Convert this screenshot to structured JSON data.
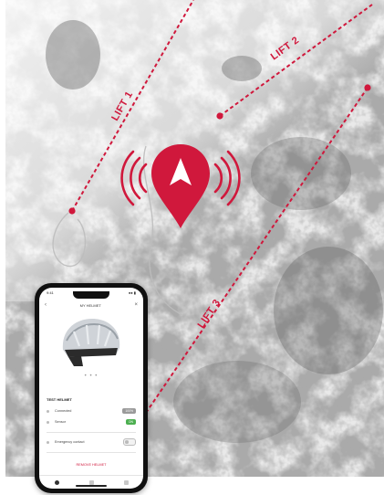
{
  "map": {
    "style": "grayscale satellite terrain, snowy slopes and forest patches",
    "accent_color": "#d0183c",
    "lifts": [
      {
        "name": "LIFT 1",
        "style": "dashed",
        "start_marker": true,
        "end_marker": false
      },
      {
        "name": "LIFT 2",
        "style": "dashed",
        "start_marker": true,
        "end_marker": false
      },
      {
        "name": "LIFT 3",
        "style": "dashed",
        "start_marker": false,
        "end_marker": true
      }
    ],
    "locator": {
      "icon": "location-pin-signal-icon"
    }
  },
  "phone": {
    "status_time": "9:41",
    "status_icons": "●● ▮",
    "header_title": "MY HELMET",
    "back_icon": "chevron-left-icon",
    "close_icon": "close-icon",
    "pager_dots": "• • •",
    "section_title": "TEST HELMET",
    "rows": [
      {
        "label": "Connected",
        "value": "100%",
        "badge_color": "#9a9a9a"
      },
      {
        "label": "Sensor",
        "value": "ON",
        "badge_color": "#4caf50"
      },
      {
        "label": "Emergency contact",
        "value": ""
      }
    ],
    "link": "REMOVE HELMET",
    "tabs": [
      "home-tab-icon",
      "map-tab-icon",
      "profile-tab-icon"
    ]
  }
}
